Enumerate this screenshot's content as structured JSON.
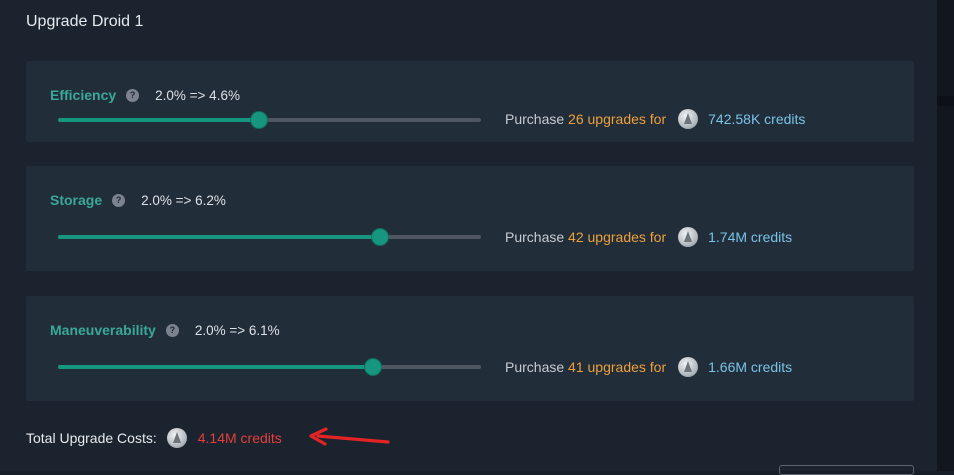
{
  "dialog": {
    "title": "Upgrade Droid 1"
  },
  "stats": [
    {
      "name": "Efficiency",
      "change": "2.0% => 4.6%",
      "slider_fraction": 0.475,
      "purchase_prefix": "Purchase",
      "upgrades": "26 upgrades",
      "for_text": "for",
      "credits": "742.58K credits"
    },
    {
      "name": "Storage",
      "change": "2.0% => 6.2%",
      "slider_fraction": 0.762,
      "purchase_prefix": "Purchase",
      "upgrades": "42 upgrades",
      "for_text": "for",
      "credits": "1.74M credits"
    },
    {
      "name": "Maneuverability",
      "change": "2.0% => 6.1%",
      "slider_fraction": 0.745,
      "purchase_prefix": "Purchase",
      "upgrades": "41 upgrades",
      "for_text": "for",
      "credits": "1.66M credits"
    }
  ],
  "total": {
    "label": "Total Upgrade Costs:",
    "credits": "4.14M credits"
  },
  "icons": {
    "help": "question-circle-icon",
    "currency": "credit-coin-icon",
    "annotation": "red-arrow-icon"
  },
  "colors": {
    "accent_teal": "#16957f",
    "stat_label": "#3aa898",
    "upgrade_count": "#eda03a",
    "credits_blue": "#79c3e6",
    "total_red": "#e43f3c"
  }
}
